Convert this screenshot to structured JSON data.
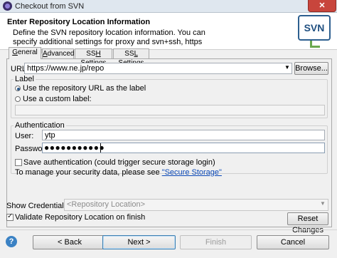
{
  "window": {
    "title": "Checkout from SVN",
    "close": "✕"
  },
  "header": {
    "title": "Enter Repository Location Information",
    "description": "Define the SVN repository location information. You can specify additional settings for proxy and svn+ssh, https connections.",
    "logo_text": "SVN"
  },
  "tabs": [
    {
      "label": "General"
    },
    {
      "label": "Advanced"
    },
    {
      "label": "SSH Settings"
    },
    {
      "label": "SSL Settings"
    }
  ],
  "url": {
    "label": "URL:",
    "value": "https://www.ne.jp/repo",
    "browse": "Browse..."
  },
  "label_group": {
    "title": "Label",
    "use_repo_url": "Use the repository URL as the label",
    "use_custom": "Use a custom label:",
    "custom_value": ""
  },
  "auth_group": {
    "title": "Authentication",
    "user_label": "User:",
    "user_value": "ytp",
    "password_label": "Password:",
    "password_mask": "●●●●●●●●●●●",
    "save_auth": "Save authentication (could trigger secure storage login)",
    "secure_prefix": "To manage your security data, please see ",
    "secure_link": "\"Secure Storage\""
  },
  "credentials": {
    "label": "Show Credentials For:",
    "value": "<Repository Location>"
  },
  "validate": {
    "label": "Validate Repository Location on finish",
    "checked": true
  },
  "reset_label": "Reset Changes",
  "buttons": {
    "help": "?",
    "back": "< Back",
    "next": "Next >",
    "finish": "Finish",
    "cancel": "Cancel"
  }
}
